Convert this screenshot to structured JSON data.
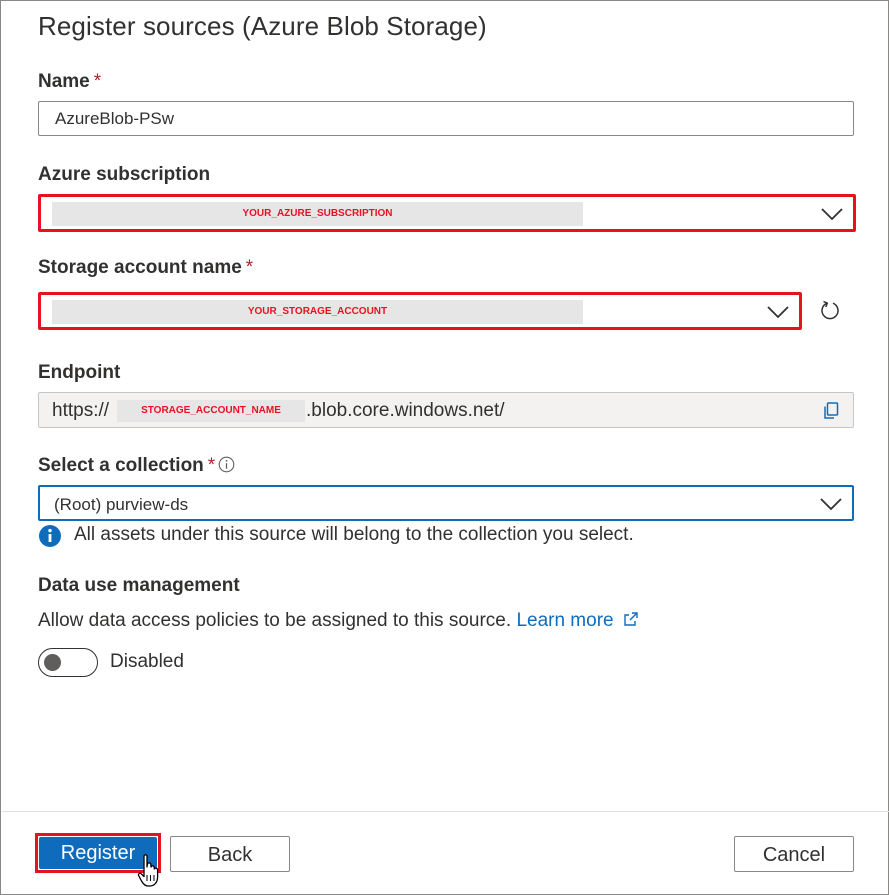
{
  "page": {
    "title": "Register sources (Azure Blob Storage)"
  },
  "name_field": {
    "label": "Name",
    "required_mark": "*",
    "value": "AzureBlob-PSw"
  },
  "subscription_field": {
    "label": "Azure subscription",
    "value": "YOUR_AZURE_SUBSCRIPTION"
  },
  "storage_field": {
    "label": "Storage account name",
    "required_mark": "*",
    "value": "YOUR_STORAGE_ACCOUNT"
  },
  "endpoint_field": {
    "label": "Endpoint",
    "prefix": "https://",
    "redacted": "STORAGE_ACCOUNT_NAME",
    "suffix": ".blob.core.windows.net/"
  },
  "collection_field": {
    "label": "Select a collection",
    "required_mark": "*",
    "value": "(Root) purview-ds",
    "info_message": "All assets under this source will belong to the collection you select."
  },
  "data_use": {
    "heading": "Data use management",
    "description": "Allow data access policies to be assigned to this source.",
    "learn_more": "Learn more",
    "toggle_state": "Disabled"
  },
  "footer": {
    "register_label": "Register",
    "back_label": "Back",
    "cancel_label": "Cancel"
  },
  "colors": {
    "highlight": "#e81123",
    "accent": "#0f6cbd",
    "required": "#a4262c"
  },
  "icons": {
    "dropdown": "chevron-down-icon",
    "refresh": "refresh-icon",
    "copy": "copy-icon",
    "info": "info-icon",
    "external_link": "external-link-icon",
    "cursor": "hand-cursor-icon"
  }
}
